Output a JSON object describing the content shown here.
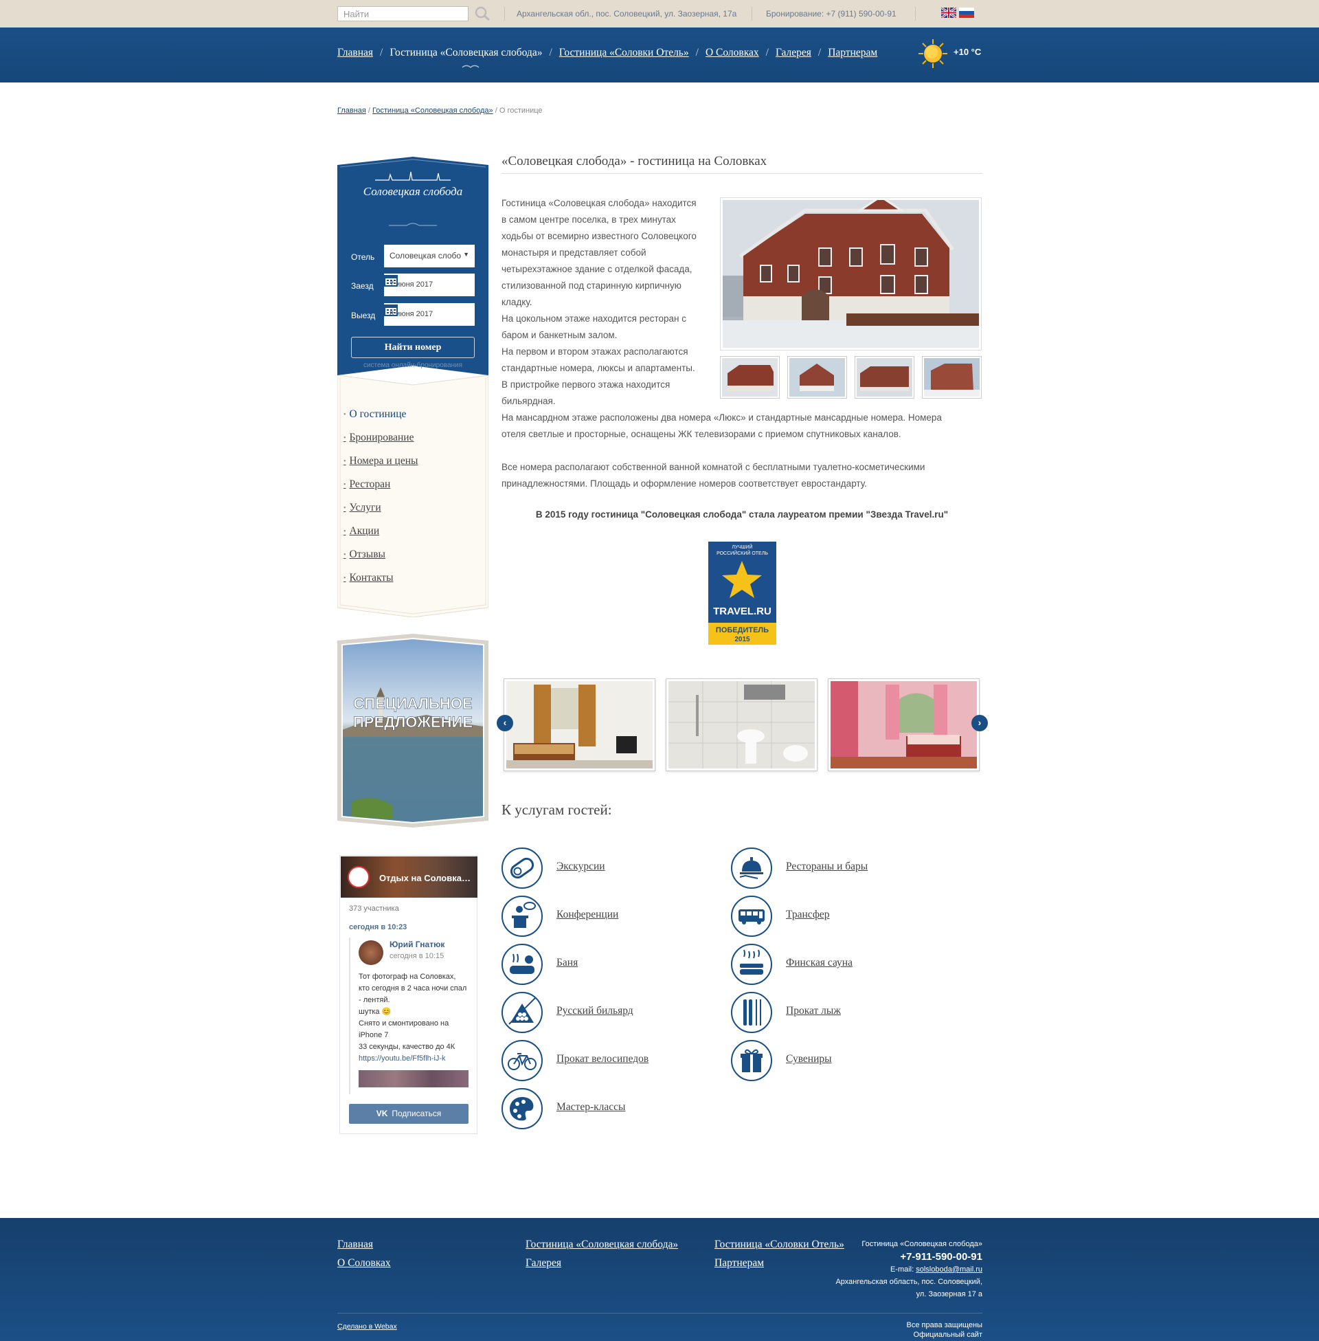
{
  "topbar": {
    "search_placeholder": "Найти",
    "address": "Архангельская обл., пос. Соловецкий, ул. Заозерная, 17а",
    "booking": "Бронирование: +7 (911) 590-00-91"
  },
  "nav": {
    "items": [
      "Главная",
      "Гостиница «Соловецкая слобода»",
      "Гостиница «Соловки Отель»",
      "О Соловках",
      "Галерея",
      "Партнерам"
    ],
    "temperature": "+10 °C"
  },
  "breadcrumb": {
    "home": "Главная",
    "hotel": "Гостиница «Соловецкая слобода»",
    "current": "О гостинице"
  },
  "booking": {
    "logo_text": "Соловецкая слобода",
    "hotel_label": "Отель",
    "hotel_value": "Соловецкая слобо",
    "checkin_label": "Заезд",
    "checkin_value": "7 июня 2017",
    "checkout_label": "Выезд",
    "checkout_value": "8 июня 2017",
    "find_button": "Найти номер",
    "subtitle": "система онлайн-бронирования"
  },
  "menu": [
    "О гостинице",
    "Бронирование",
    "Номера и цены",
    "Ресторан",
    "Услуги",
    "Акции",
    "Отзывы",
    "Контакты"
  ],
  "special": {
    "line1": "СПЕЦИАЛЬНОЕ",
    "line2": "ПРЕДЛОЖЕНИЕ"
  },
  "vk": {
    "group_name": "Отдых на Соловках...",
    "members": "373 участника",
    "time": "сегодня в 10:23",
    "author": "Юрий Гнатюк",
    "post_time": "сегодня в 10:15",
    "post_text": "Тот фотограф на Соловках, кто сегодня в 2 часа ночи спал - лентяй.\nшутка 😊\nСнято и смонтировано на iPhone 7\n33 секунды, качество до 4К",
    "post_link": "https://youtu.be/Ff5flh-iJ-k",
    "subscribe": "Подписаться"
  },
  "main": {
    "title": "«Соловецкая слобода» - гостиница на Соловках",
    "paragraph_lines": [
      "Гостиница «Соловецкая слобода» находится",
      "в самом центре поселка, в трех минутах",
      "ходьбы от всемирно известного Соловецкого",
      "монастыря и представляет собой",
      "четырехэтажное здание с отделкой фасада,",
      "стилизованной под старинную кирпичную",
      "кладку.",
      "На цокольном этаже находится ресторан с",
      "баром и банкетным залом.",
      "На первом и втором этажах располагаются",
      "стандартные номера, люксы и апартаменты.",
      "В пристройке первого этажа находится",
      "бильярдная.",
      "На мансардном этаже расположены два номера «Люкс» и стандартные мансардные номера. Номера",
      "отеля светлые и просторные, оснащены ЖК телевизорами с приемом спутниковых каналов.",
      "",
      "Все номера располагают собственной ванной комнатой с бесплатными туалетно-косметическими",
      "принадлежностями. Площадь и оформление номеров соответствует евростандарту."
    ],
    "award_text": "В 2015 году гостиница \"Соловецкая слобода\" стала лауреатом премии \"Звезда Travel.ru\"",
    "award_badge": {
      "line1": "ЛУЧШИЙ",
      "line2": "РОССИЙСКИЙ ОТЕЛЬ",
      "brand": "TRAVEL.RU",
      "winner": "ПОБЕДИТЕЛЬ",
      "year": "2015"
    },
    "services_title": "К услугам гостей:",
    "services_left": [
      "Экскурсии",
      "Конференции",
      "Баня",
      "Русский бильярд",
      "Прокат велосипедов",
      "Мастер-классы"
    ],
    "services_right": [
      "Рестораны и бары",
      "Трансфер",
      "Финская сауна",
      "Прокат лыж",
      "Сувениры"
    ]
  },
  "footer": {
    "col1": [
      "Главная",
      "О Соловках"
    ],
    "col2": [
      "Гостиница «Соловецкая слобода»",
      "Галерея"
    ],
    "col3": [
      "Гостиница «Соловки Отель»",
      "Партнерам"
    ],
    "hotel": "Гостиница «Соловецкая слобода»",
    "phone": "+7-911-590-00-91",
    "email_label": "E-mail:",
    "email": "solsloboda@mail.ru",
    "address1": "Архангельская область, пос. Соловецкий,",
    "address2": "ул. Заозерная 17 а",
    "made_by": "Сделано в Webax",
    "rights": "Все права защищены",
    "official": "Официальный сайт"
  },
  "colors": {
    "primary": "#1a4f86",
    "topbar": "#e3dccf",
    "award_blue": "#1c4f8c",
    "award_yellow": "#f6c21a"
  }
}
